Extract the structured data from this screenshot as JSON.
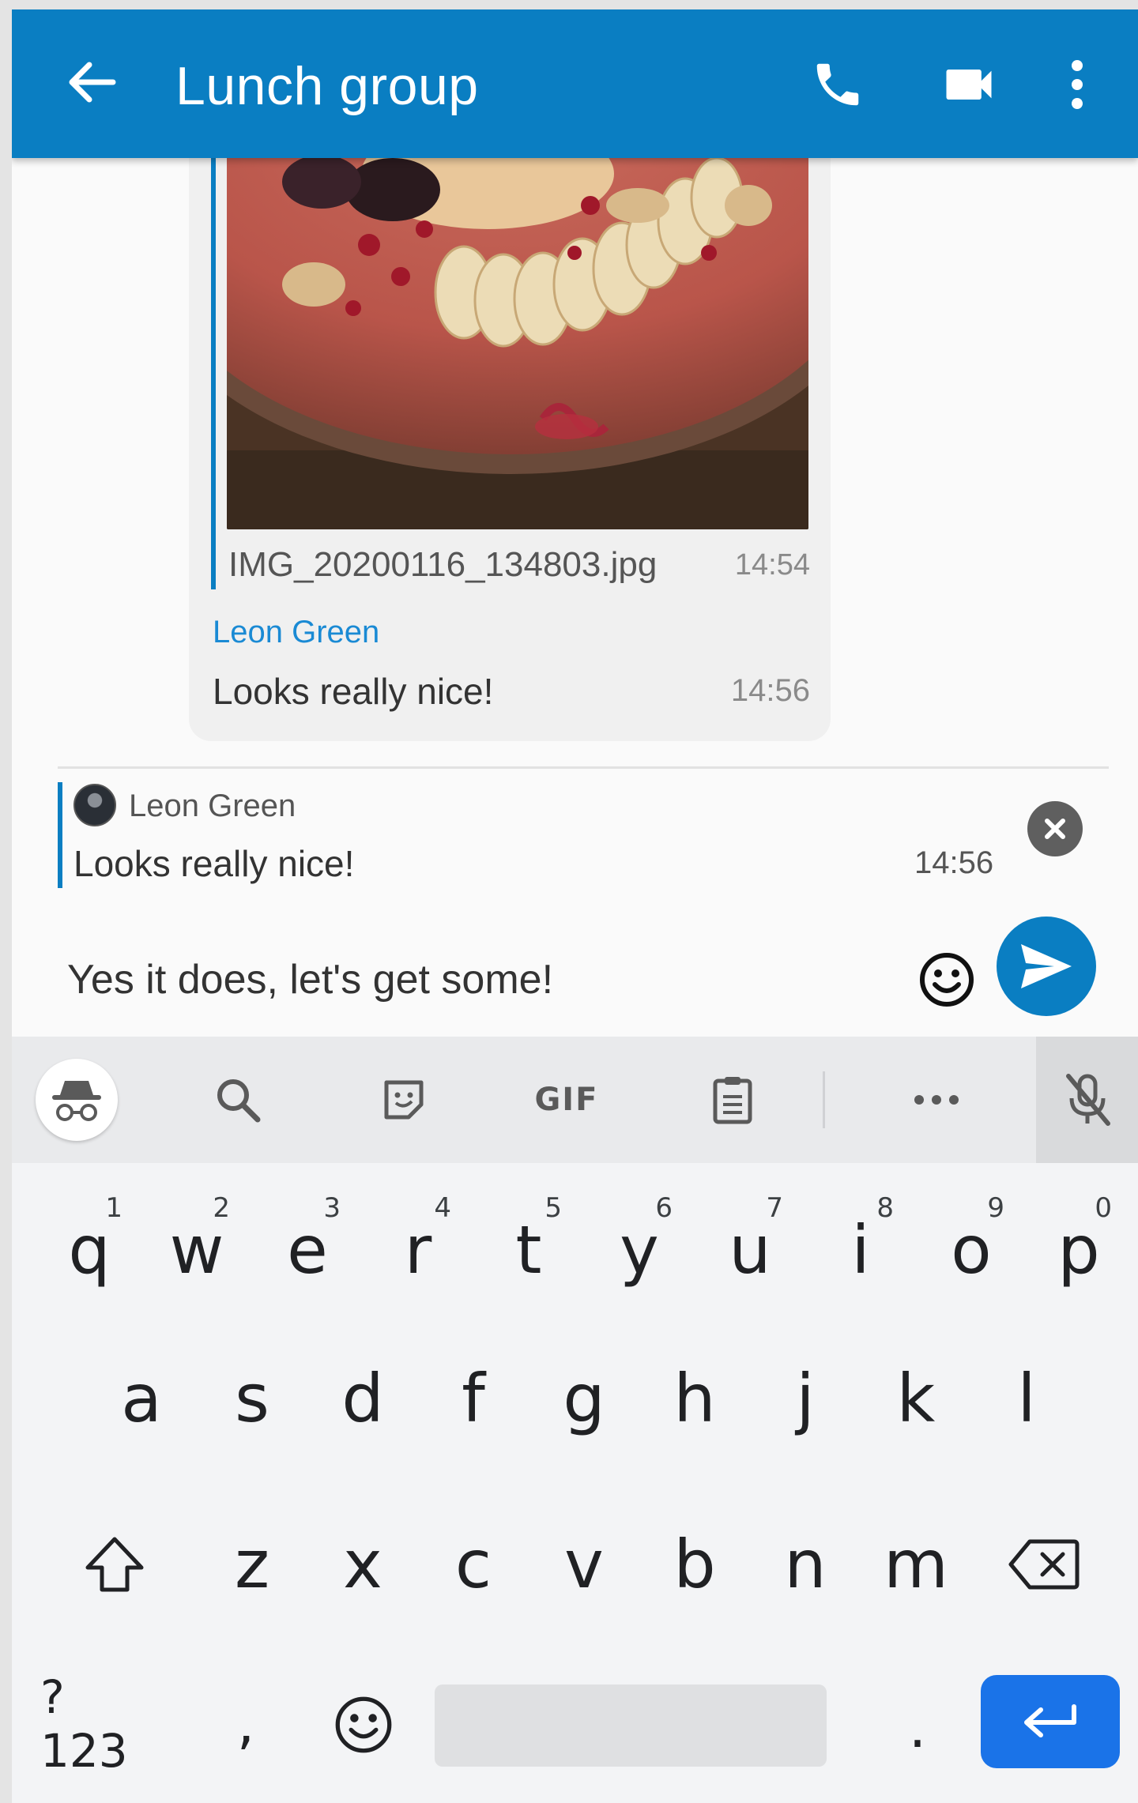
{
  "app_bar": {
    "title": "Lunch group",
    "bg_color": "#0a7ec2",
    "icons": [
      "arrow-back-icon",
      "phone-icon",
      "videocam-icon",
      "more-vert-icon"
    ]
  },
  "messages": {
    "image_message": {
      "filename": "IMG_20200116_134803.jpg",
      "time": "14:54"
    },
    "text_message": {
      "sender": "Leon Green",
      "text": "Looks really nice!",
      "time": "14:56"
    }
  },
  "reply_preview": {
    "sender": "Leon Green",
    "text": "Looks really nice!",
    "time": "14:56"
  },
  "composer": {
    "value": "Yes it does, let's get some!"
  },
  "keyboard": {
    "toolbar_gif": "GIF",
    "row1": [
      {
        "k": "q",
        "n": "1"
      },
      {
        "k": "w",
        "n": "2"
      },
      {
        "k": "e",
        "n": "3"
      },
      {
        "k": "r",
        "n": "4"
      },
      {
        "k": "t",
        "n": "5"
      },
      {
        "k": "y",
        "n": "6"
      },
      {
        "k": "u",
        "n": "7"
      },
      {
        "k": "i",
        "n": "8"
      },
      {
        "k": "o",
        "n": "9"
      },
      {
        "k": "p",
        "n": "0"
      }
    ],
    "row2": [
      "a",
      "s",
      "d",
      "f",
      "g",
      "h",
      "j",
      "k",
      "l"
    ],
    "row3": [
      "z",
      "x",
      "c",
      "v",
      "b",
      "n",
      "m"
    ],
    "symbols_label": "?123",
    "comma": ",",
    "period": "."
  }
}
